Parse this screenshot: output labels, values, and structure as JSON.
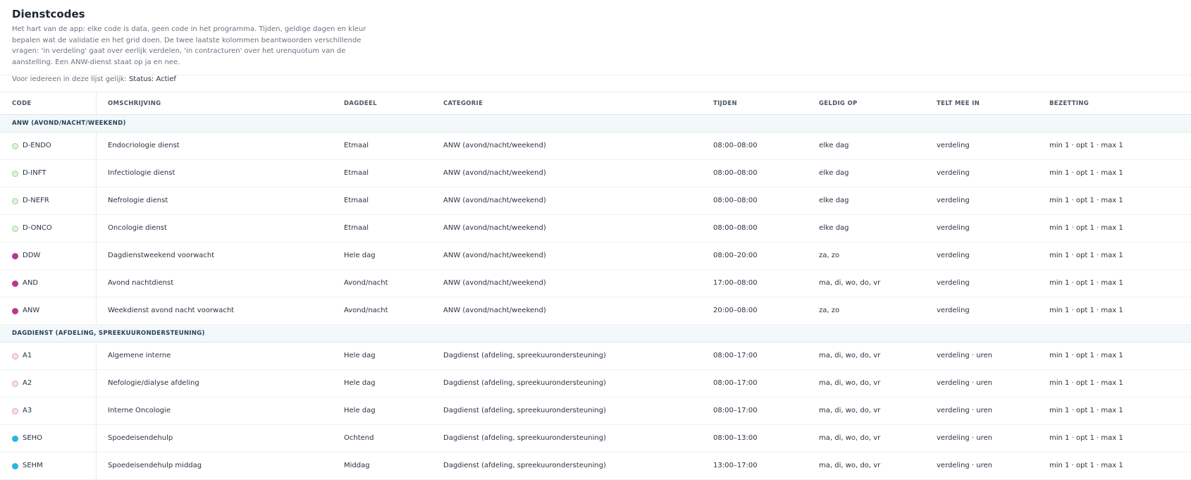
{
  "header": {
    "title": "Dienstcodes",
    "description": "Het hart van de app: elke code is data, geen code in het programma. Tijden, geldige dagen en kleur bepalen wat de validatie en het grid doen. De twee laatste kolommen beantwoorden verschillende vragen: 'in verdeling' gaat over eerlijk verdelen, 'in contracturen' over het urenquotum van de aanstelling. Een ANW-dienst staat op ja en nee.",
    "filter_label": "Voor iedereen in deze lijst gelijk:",
    "filter_value": "Status: Actief"
  },
  "columns": {
    "code": "CODE",
    "omschrijving": "OMSCHRIJVING",
    "dagdeel": "DAGDEEL",
    "categorie": "CATEGORIE",
    "tijden": "TIJDEN",
    "geldig_op": "GELDIG OP",
    "telt_mee_in": "TELT MEE IN",
    "bezetting": "BEZETTING"
  },
  "groups": [
    {
      "label": "ANW (AVOND/NACHT/WEEKEND)",
      "rows": [
        {
          "code": "D-ENDO",
          "omschrijving": "Endocriologie dienst",
          "dagdeel": "Etmaal",
          "categorie": "ANW (avond/nacht/weekend)",
          "tijden": "08:00–08:00",
          "geldig_op": "elke dag",
          "telt_mee_in": "verdeling",
          "bezetting": "min 1 · opt 1 · max 1",
          "color": "#9fd49a",
          "style": "ring"
        },
        {
          "code": "D-INFT",
          "omschrijving": "Infectiologie dienst",
          "dagdeel": "Etmaal",
          "categorie": "ANW (avond/nacht/weekend)",
          "tijden": "08:00–08:00",
          "geldig_op": "elke dag",
          "telt_mee_in": "verdeling",
          "bezetting": "min 1 · opt 1 · max 1",
          "color": "#9fd49a",
          "style": "ring"
        },
        {
          "code": "D-NEFR",
          "omschrijving": "Nefrologie dienst",
          "dagdeel": "Etmaal",
          "categorie": "ANW (avond/nacht/weekend)",
          "tijden": "08:00–08:00",
          "geldig_op": "elke dag",
          "telt_mee_in": "verdeling",
          "bezetting": "min 1 · opt 1 · max 1",
          "color": "#9fd49a",
          "style": "ring"
        },
        {
          "code": "D-ONCO",
          "omschrijving": "Oncologie dienst",
          "dagdeel": "Etmaal",
          "categorie": "ANW (avond/nacht/weekend)",
          "tijden": "08:00–08:00",
          "geldig_op": "elke dag",
          "telt_mee_in": "verdeling",
          "bezetting": "min 1 · opt 1 · max 1",
          "color": "#9fd49a",
          "style": "ring"
        },
        {
          "code": "DDW",
          "omschrijving": "Dagdienstweekend voorwacht",
          "dagdeel": "Hele dag",
          "categorie": "ANW (avond/nacht/weekend)",
          "tijden": "08:00–20:00",
          "geldig_op": "za, zo",
          "telt_mee_in": "verdeling",
          "bezetting": "min 1 · opt 1 · max 1",
          "color": "#b8378f",
          "style": "solid"
        },
        {
          "code": "AND",
          "omschrijving": "Avond nachtdienst",
          "dagdeel": "Avond/nacht",
          "categorie": "ANW (avond/nacht/weekend)",
          "tijden": "17:00–08:00",
          "geldig_op": "ma, di, wo, do, vr",
          "telt_mee_in": "verdeling",
          "bezetting": "min 1 · opt 1 · max 1",
          "color": "#b8378f",
          "style": "solid"
        },
        {
          "code": "ANW",
          "omschrijving": "Weekdienst avond nacht voorwacht",
          "dagdeel": "Avond/nacht",
          "categorie": "ANW (avond/nacht/weekend)",
          "tijden": "20:00–08:00",
          "geldig_op": "za, zo",
          "telt_mee_in": "verdeling",
          "bezetting": "min 1 · opt 1 · max 1",
          "color": "#b8378f",
          "style": "solid"
        }
      ]
    },
    {
      "label": "DAGDIENST (AFDELING, SPREEKUURONDERSTEUNING)",
      "rows": [
        {
          "code": "A1",
          "omschrijving": "Algemene interne",
          "dagdeel": "Hele dag",
          "categorie": "Dagdienst (afdeling, spreekuurondersteuning)",
          "tijden": "08:00–17:00",
          "geldig_op": "ma, di, wo, do, vr",
          "telt_mee_in": "verdeling · uren",
          "bezetting": "min 1 · opt 1 · max 1",
          "color": "#e2a0c6",
          "style": "ring"
        },
        {
          "code": "A2",
          "omschrijving": "Nefologie/dialyse afdeling",
          "dagdeel": "Hele dag",
          "categorie": "Dagdienst (afdeling, spreekuurondersteuning)",
          "tijden": "08:00–17:00",
          "geldig_op": "ma, di, wo, do, vr",
          "telt_mee_in": "verdeling · uren",
          "bezetting": "min 1 · opt 1 · max 1",
          "color": "#e2a0c6",
          "style": "ring"
        },
        {
          "code": "A3",
          "omschrijving": "Interne Oncologie",
          "dagdeel": "Hele dag",
          "categorie": "Dagdienst (afdeling, spreekuurondersteuning)",
          "tijden": "08:00–17:00",
          "geldig_op": "ma, di, wo, do, vr",
          "telt_mee_in": "verdeling · uren",
          "bezetting": "min 1 · opt 1 · max 1",
          "color": "#e2a0c6",
          "style": "ring"
        },
        {
          "code": "SEHO",
          "omschrijving": "Spoedeisendehulp",
          "dagdeel": "Ochtend",
          "categorie": "Dagdienst (afdeling, spreekuurondersteuning)",
          "tijden": "08:00–13:00",
          "geldig_op": "ma, di, wo, do, vr",
          "telt_mee_in": "verdeling · uren",
          "bezetting": "min 1 · opt 1 · max 1",
          "color": "#29b6e0",
          "style": "solid"
        },
        {
          "code": "SEHM",
          "omschrijving": "Spoedeisendehulp middag",
          "dagdeel": "Middag",
          "categorie": "Dagdienst (afdeling, spreekuurondersteuning)",
          "tijden": "13:00–17:00",
          "geldig_op": "ma, di, wo, do, vr",
          "telt_mee_in": "verdeling · uren",
          "bezetting": "min 1 · opt 1 · max 1",
          "color": "#29b6e0",
          "style": "solid"
        }
      ]
    }
  ]
}
